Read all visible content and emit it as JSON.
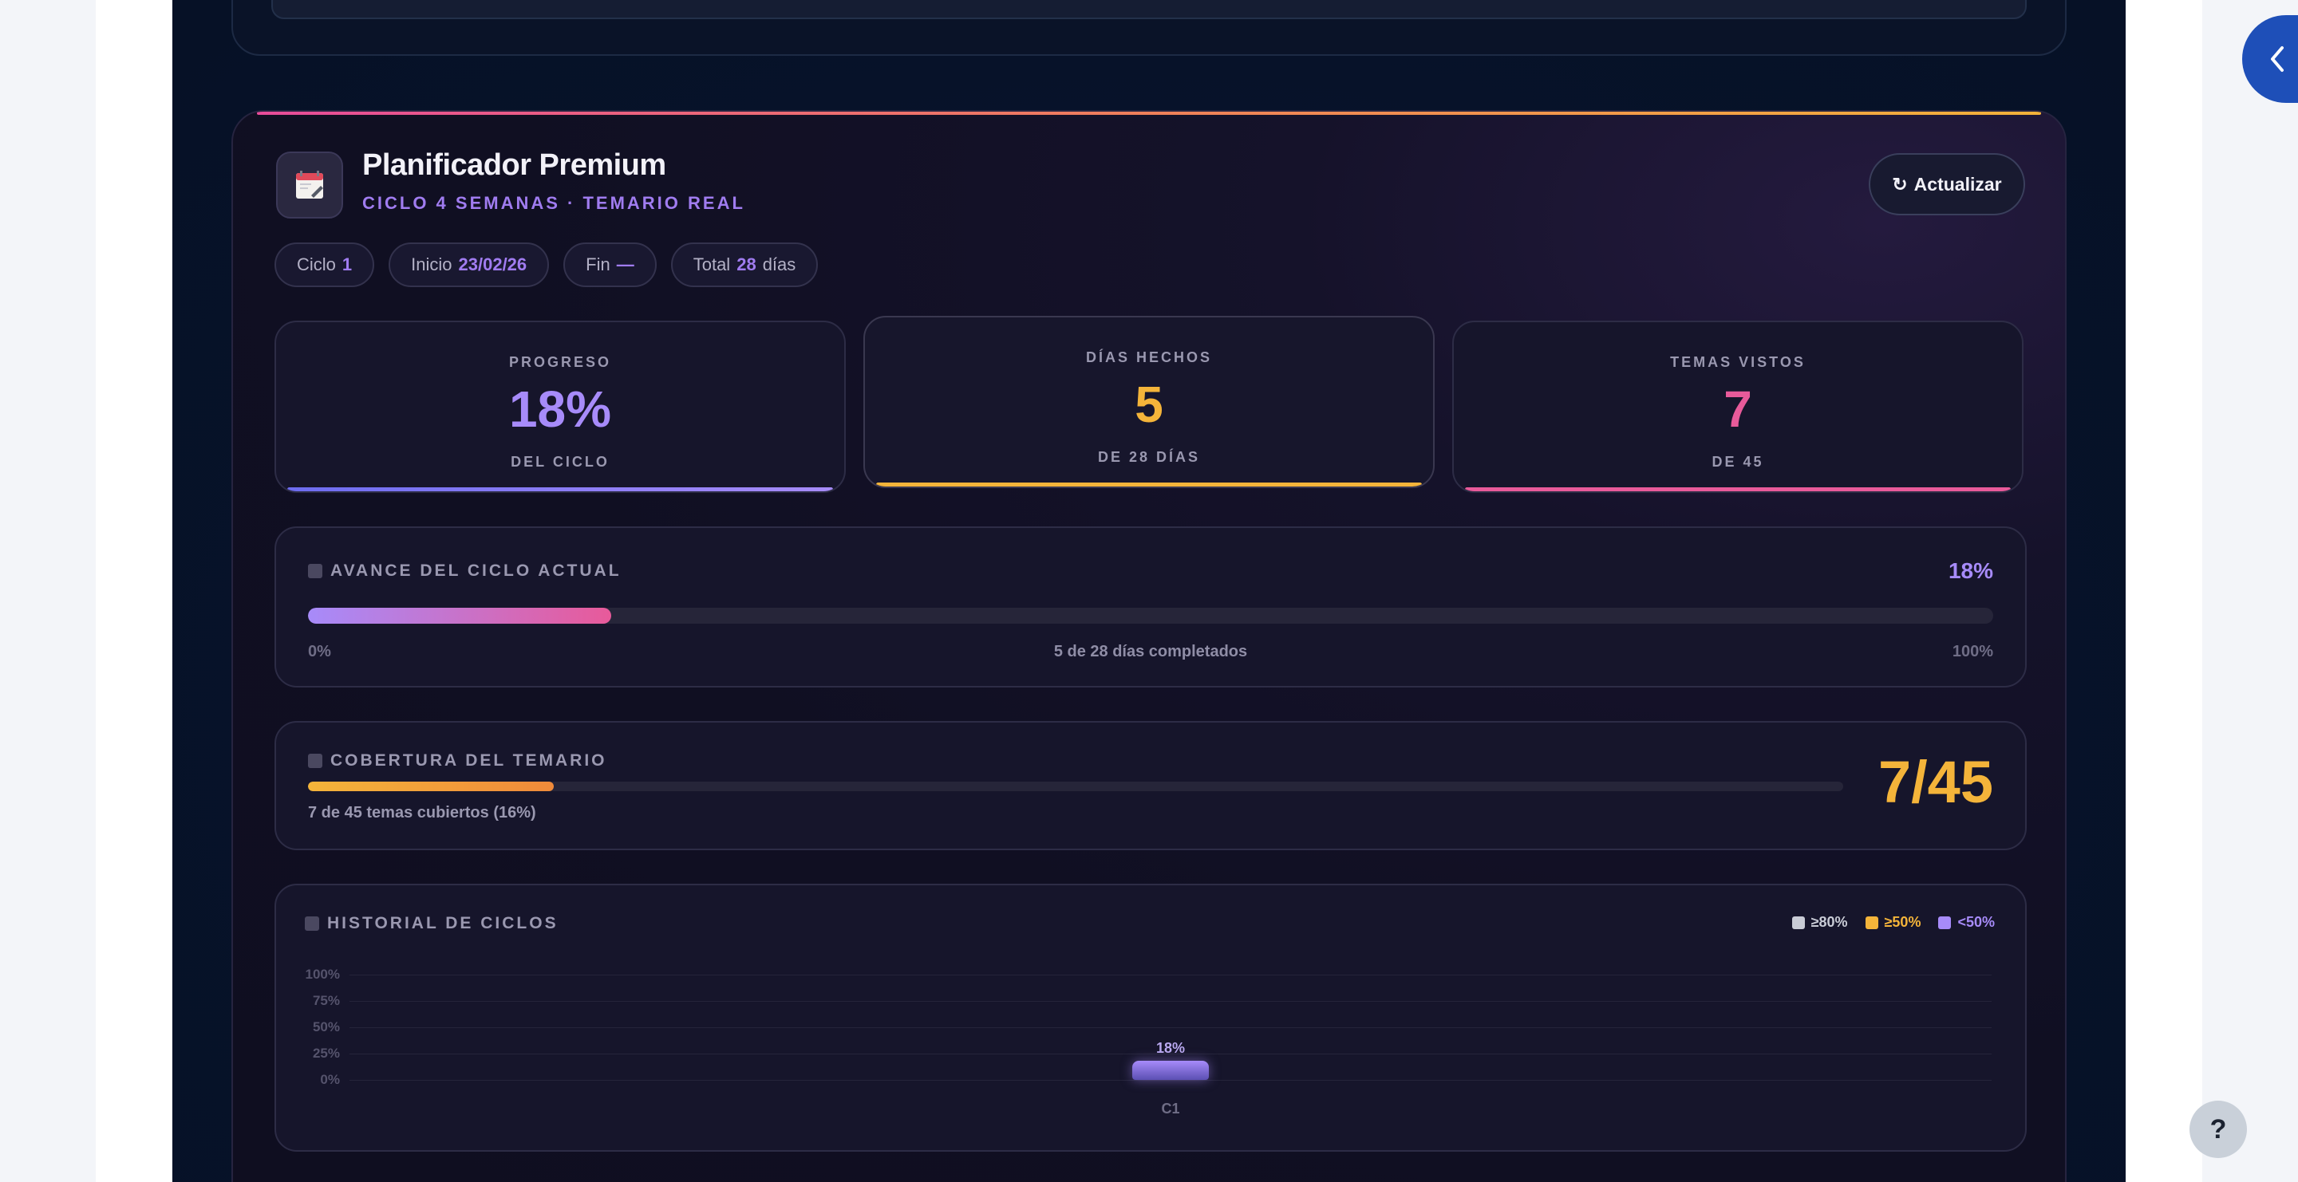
{
  "header": {
    "title": "Planificador Premium",
    "subtitle": "CICLO 4 SEMANAS · TEMARIO REAL",
    "refresh_label": "Actualizar",
    "refresh_icon": "↻",
    "icon": "calendar-icon"
  },
  "chips": [
    {
      "label": "Ciclo",
      "value": "1"
    },
    {
      "label": "Inicio",
      "value": "23/02/26"
    },
    {
      "label": "Fin",
      "value": "—"
    },
    {
      "label": "Total",
      "value": "28",
      "suffix": "días"
    }
  ],
  "stats": {
    "progress": {
      "label": "PROGRESO",
      "value": "18%",
      "sub": "DEL CICLO",
      "color": "#a78bfa"
    },
    "days": {
      "label": "DÍAS HECHOS",
      "value": "5",
      "sub": "DE 28 DÍAS",
      "color": "#f4b43a"
    },
    "topics": {
      "label": "TEMAS VISTOS",
      "value": "7",
      "sub": "DE 45",
      "color": "#e85a9a"
    }
  },
  "cycle_progress": {
    "title": "AVANCE DEL CICLO ACTUAL",
    "percent_label": "18%",
    "fraction": 0.18,
    "min_label": "0%",
    "max_label": "100%",
    "caption": "5 de 28 días completados"
  },
  "coverage": {
    "title": "COBERTURA DEL TEMARIO",
    "caption": "7 de 45 temas cubiertos (16%)",
    "big_value": "7/45",
    "fraction": 0.16
  },
  "history": {
    "title": "HISTORIAL DE CICLOS",
    "legend": [
      {
        "label": "≥80%",
        "color": "#c9ccd6"
      },
      {
        "label": "≥50%",
        "color": "#f4b43a"
      },
      {
        "label": "<50%",
        "color": "#a78bfa"
      }
    ]
  },
  "chart_data": {
    "type": "bar",
    "title": "HISTORIAL DE CICLOS",
    "categories": [
      "C1"
    ],
    "values": [
      18
    ],
    "data_labels": [
      "18%"
    ],
    "y_ticks": [
      "100%",
      "75%",
      "50%",
      "25%",
      "0%"
    ],
    "ylim": [
      0,
      100
    ],
    "grid": true,
    "legend_position": "top-right"
  },
  "help_label": "?"
}
